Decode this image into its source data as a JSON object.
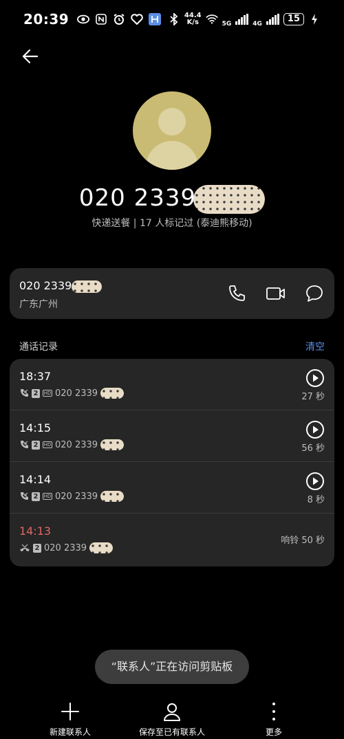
{
  "status_bar": {
    "time": "20:39",
    "net_speed_value": "44.4",
    "net_speed_unit": "K/s",
    "net1": "5G",
    "net2": "4G",
    "battery": "15"
  },
  "contact": {
    "number_prefix": "020 2339",
    "tag_line": "快递送餐 | 17 人标记过 (泰迪熊移动)",
    "avatar_color": "#cabb74"
  },
  "number_card": {
    "number_prefix": "020 2339",
    "location": "广东广州"
  },
  "call_log": {
    "title": "通话记录",
    "clear_label": "清空",
    "items": [
      {
        "time": "18:37",
        "sim": "2",
        "number_prefix": "020 2339",
        "duration": "27 秒",
        "missed": false
      },
      {
        "time": "14:15",
        "sim": "2",
        "number_prefix": "020 2339",
        "duration": "56 秒",
        "missed": false
      },
      {
        "time": "14:14",
        "sim": "2",
        "number_prefix": "020 2339",
        "duration": "8 秒",
        "missed": false
      },
      {
        "time": "14:13",
        "sim": "2",
        "number_prefix": "020 2339",
        "duration": "响铃 50 秒",
        "missed": true
      }
    ],
    "hd_label": "HD"
  },
  "toast": {
    "text": "“联系人”正在访问剪贴板"
  },
  "bottom_bar": {
    "new_contact": "新建联系人",
    "save_existing": "保存至已有联系人",
    "more": "更多"
  },
  "colors": {
    "accent": "#5b8ee6",
    "missed": "#e0665f",
    "card": "#262626"
  }
}
